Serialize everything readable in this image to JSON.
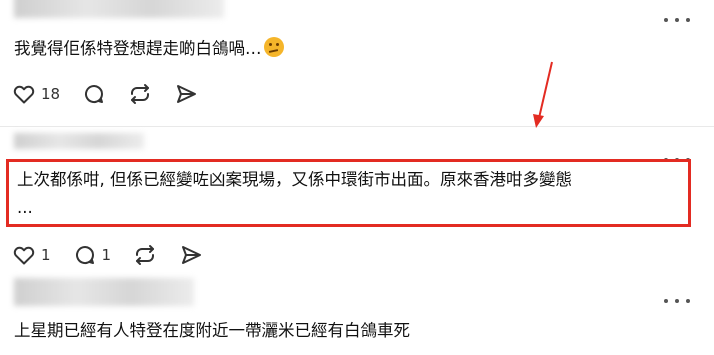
{
  "posts": [
    {
      "text": "我覺得佢係特登想趕走啲白鴿喎…",
      "emoji": "thinking-face",
      "likes": "18"
    },
    {
      "line1": "上次都係咁, 但係已經變咗凶案現場，又係中環街市出面。原來香港咁多變態",
      "line2": "...",
      "likes": "1",
      "replies": "1"
    },
    {
      "text": "上星期已經有人特登在度附近一帶灑米已經有白鴿車死"
    }
  ],
  "icons": {
    "like": "heart-icon",
    "reply": "comment-icon",
    "repost": "repost-icon",
    "share": "share-icon",
    "more": "more-icon"
  },
  "annotation": {
    "color": "#e32b22"
  }
}
